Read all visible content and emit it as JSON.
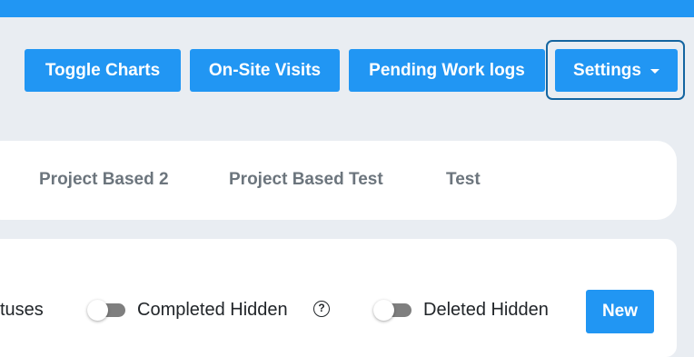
{
  "header": {
    "accent_color": "#2196f3"
  },
  "toolbar": {
    "toggle_charts_label": "Toggle Charts",
    "onsite_visits_label": "On-Site Visits",
    "pending_worklogs_label": "Pending Work logs",
    "settings_label": "Settings",
    "settings_icon": "caret-down-icon"
  },
  "tabs": [
    {
      "label": "Project Based 2"
    },
    {
      "label": "Project Based Test"
    },
    {
      "label": "Test"
    }
  ],
  "filters": {
    "statuses_partial_text": "tuses",
    "completed_hidden_label": "Completed Hidden",
    "completed_help_icon": "question-circle-icon",
    "completed_help_glyph": "?",
    "deleted_hidden_label": "Deleted Hidden",
    "new_button_label": "New"
  }
}
